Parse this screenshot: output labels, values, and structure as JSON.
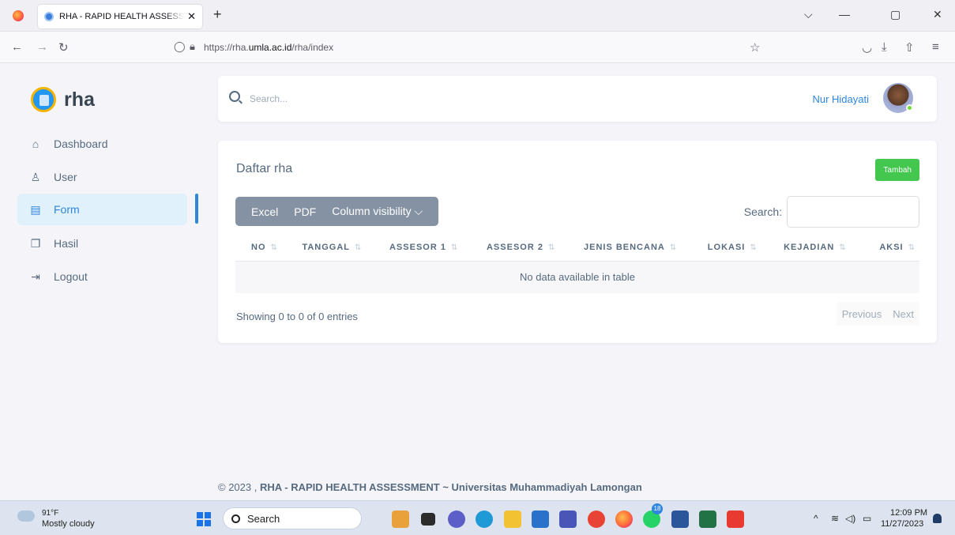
{
  "browser": {
    "tab_title": "RHA - RAPID HEALTH ASSESSMENT",
    "tab_close": "✕",
    "new_tab": "+",
    "url_prefix": "https://rha.",
    "url_domain": "umla.ac.id",
    "url_path": "/rha/index",
    "window_controls": [
      "⌵",
      "—",
      "▢",
      "✕"
    ]
  },
  "sidebar": {
    "brand": "rha",
    "items": [
      {
        "label": "Dashboard",
        "icon": "home-icon",
        "glyph": "⌂",
        "active": false
      },
      {
        "label": "User",
        "icon": "user-icon",
        "glyph": "♙",
        "active": false
      },
      {
        "label": "Form",
        "icon": "form-icon",
        "glyph": "▤",
        "active": true
      },
      {
        "label": "Hasil",
        "icon": "copy-icon",
        "glyph": "❐",
        "active": false
      },
      {
        "label": "Logout",
        "icon": "logout-icon",
        "glyph": "⇥",
        "active": false
      }
    ]
  },
  "topbar": {
    "search_placeholder": "Search...",
    "user_name": "Nur Hidayati"
  },
  "main": {
    "title": "Daftar rha",
    "add_button": "Tambah",
    "export_buttons": {
      "excel": "Excel",
      "pdf": "PDF",
      "colvis": "Column visibility ⌵"
    },
    "search_label": "Search:",
    "columns": [
      "NO",
      "TANGGAL",
      "ASSESOR 1",
      "ASSESOR 2",
      "JENIS BENCANA",
      "LOKASI",
      "KEJADIAN",
      "AKSI"
    ],
    "sort_glyph": "⇅",
    "empty_message": "No data available in table",
    "info": "Showing 0 to 0 of 0 entries",
    "prev": "Previous",
    "next": "Next"
  },
  "footer": {
    "prefix": "© 2023 , ",
    "strong": "RHA - RAPID HEALTH ASSESSMENT ~ Universitas Muhammadiyah Lamongan"
  },
  "taskbar": {
    "weather_temp": "91°F",
    "weather_desc": "Mostly cloudy",
    "search_label": "Search",
    "badges": [
      "18"
    ],
    "time": "12:09 PM",
    "date": "11/27/2023"
  },
  "colors": {
    "accent": "#2e86de",
    "add_button": "#43c74e",
    "export_group": "#8592a3",
    "active_menu_bg": "#e1f1fc"
  }
}
